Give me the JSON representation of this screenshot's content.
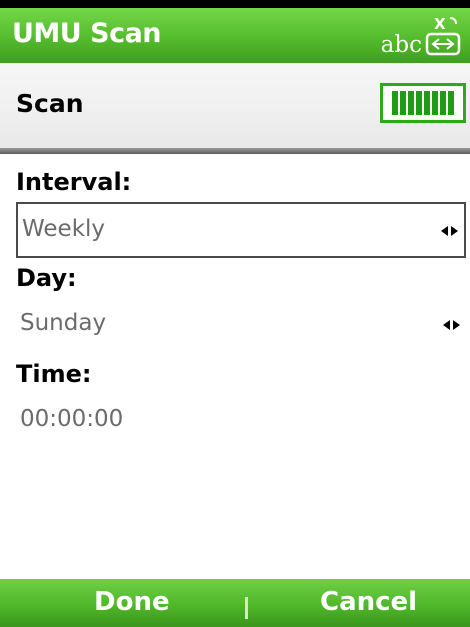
{
  "header": {
    "title": "UMU Scan",
    "input_mode": "abc",
    "input_icon": "keyboard-input-icon"
  },
  "scan": {
    "label": "Scan",
    "battery_icon": "battery-full-icon",
    "battery_level": 1.0
  },
  "form": {
    "interval": {
      "label": "Interval:",
      "value": "Weekly"
    },
    "day": {
      "label": "Day:",
      "value": "Sunday"
    },
    "time": {
      "label": "Time:",
      "value": "00:00:00"
    }
  },
  "softkeys": {
    "left_label": "Done",
    "right_label": "Cancel"
  },
  "colors": {
    "accent_green": "#54bc2c",
    "battery_green": "#1d9e10"
  }
}
